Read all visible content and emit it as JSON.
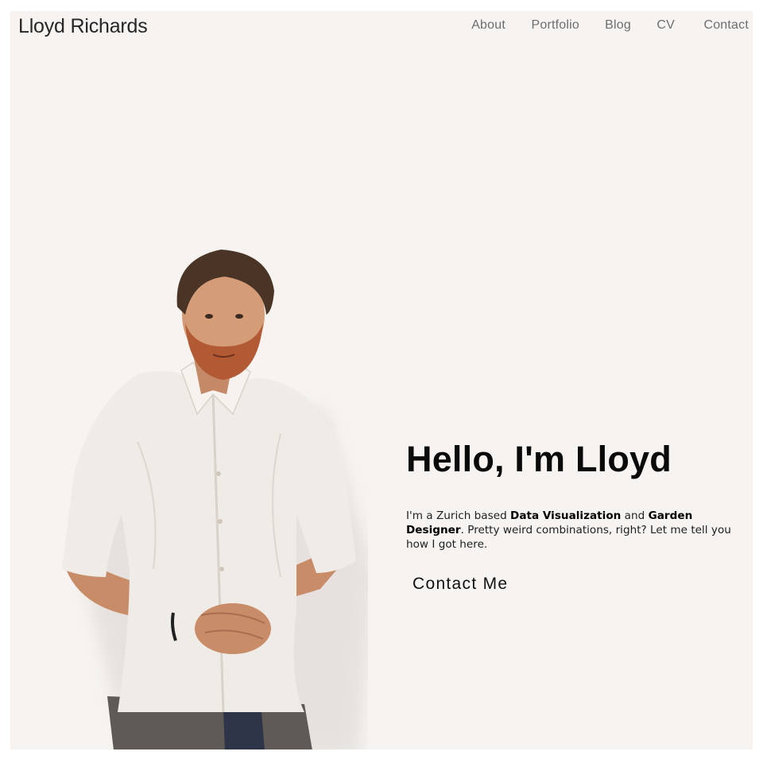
{
  "header": {
    "brand": "Lloyd Richards",
    "nav": [
      {
        "label": "About"
      },
      {
        "label": "Portfolio"
      },
      {
        "label": "Blog"
      },
      {
        "label": "CV"
      },
      {
        "label": "Contact"
      }
    ]
  },
  "hero": {
    "title": "Hello, I'm Lloyd",
    "text_parts": [
      "I'm a Zurich based ",
      "Data Visualization",
      " and ",
      "Garden Designer",
      ". Pretty weird combinations, right? Let me tell you how I got here."
    ],
    "cta_label": "Contact Me"
  },
  "colors": {
    "page_background": "#f6f3f1",
    "heading": "#0a0a0a",
    "nav_text": "#6e6e6e"
  }
}
